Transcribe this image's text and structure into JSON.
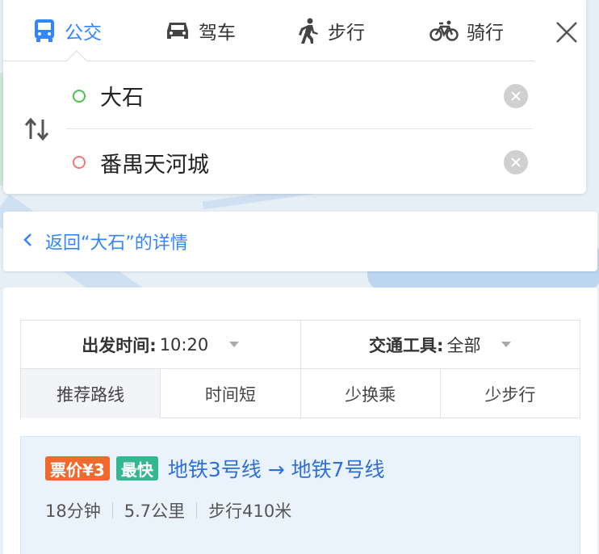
{
  "mode_tabs": [
    {
      "label": "公交",
      "icon": "bus-icon",
      "active": true
    },
    {
      "label": "驾车",
      "icon": "car-icon",
      "active": false
    },
    {
      "label": "步行",
      "icon": "walk-icon",
      "active": false
    },
    {
      "label": "骑行",
      "icon": "bike-icon",
      "active": false
    }
  ],
  "route": {
    "from": "大石",
    "to": "番禺天河城"
  },
  "back_link": "返回“大石”的详情",
  "filters": {
    "departure_label": "出发时间:",
    "departure_value": "10:20",
    "transport_label": "交通工具:",
    "transport_value": "全部"
  },
  "sort_tabs": [
    "推荐路线",
    "时间短",
    "少换乘",
    "少步行"
  ],
  "result": {
    "fare_badge": "票价¥3",
    "fast_badge": "最快",
    "title": "地铁3号线 → 地铁7号线",
    "duration": "18分钟",
    "distance": "5.7公里",
    "walk": "步行410米"
  },
  "colors": {
    "accent": "#3385ff",
    "fare_badge": "#f06a2e",
    "fast_badge": "#34b88f",
    "origin_dot": "#4cc14c",
    "destination_dot": "#f07878"
  }
}
